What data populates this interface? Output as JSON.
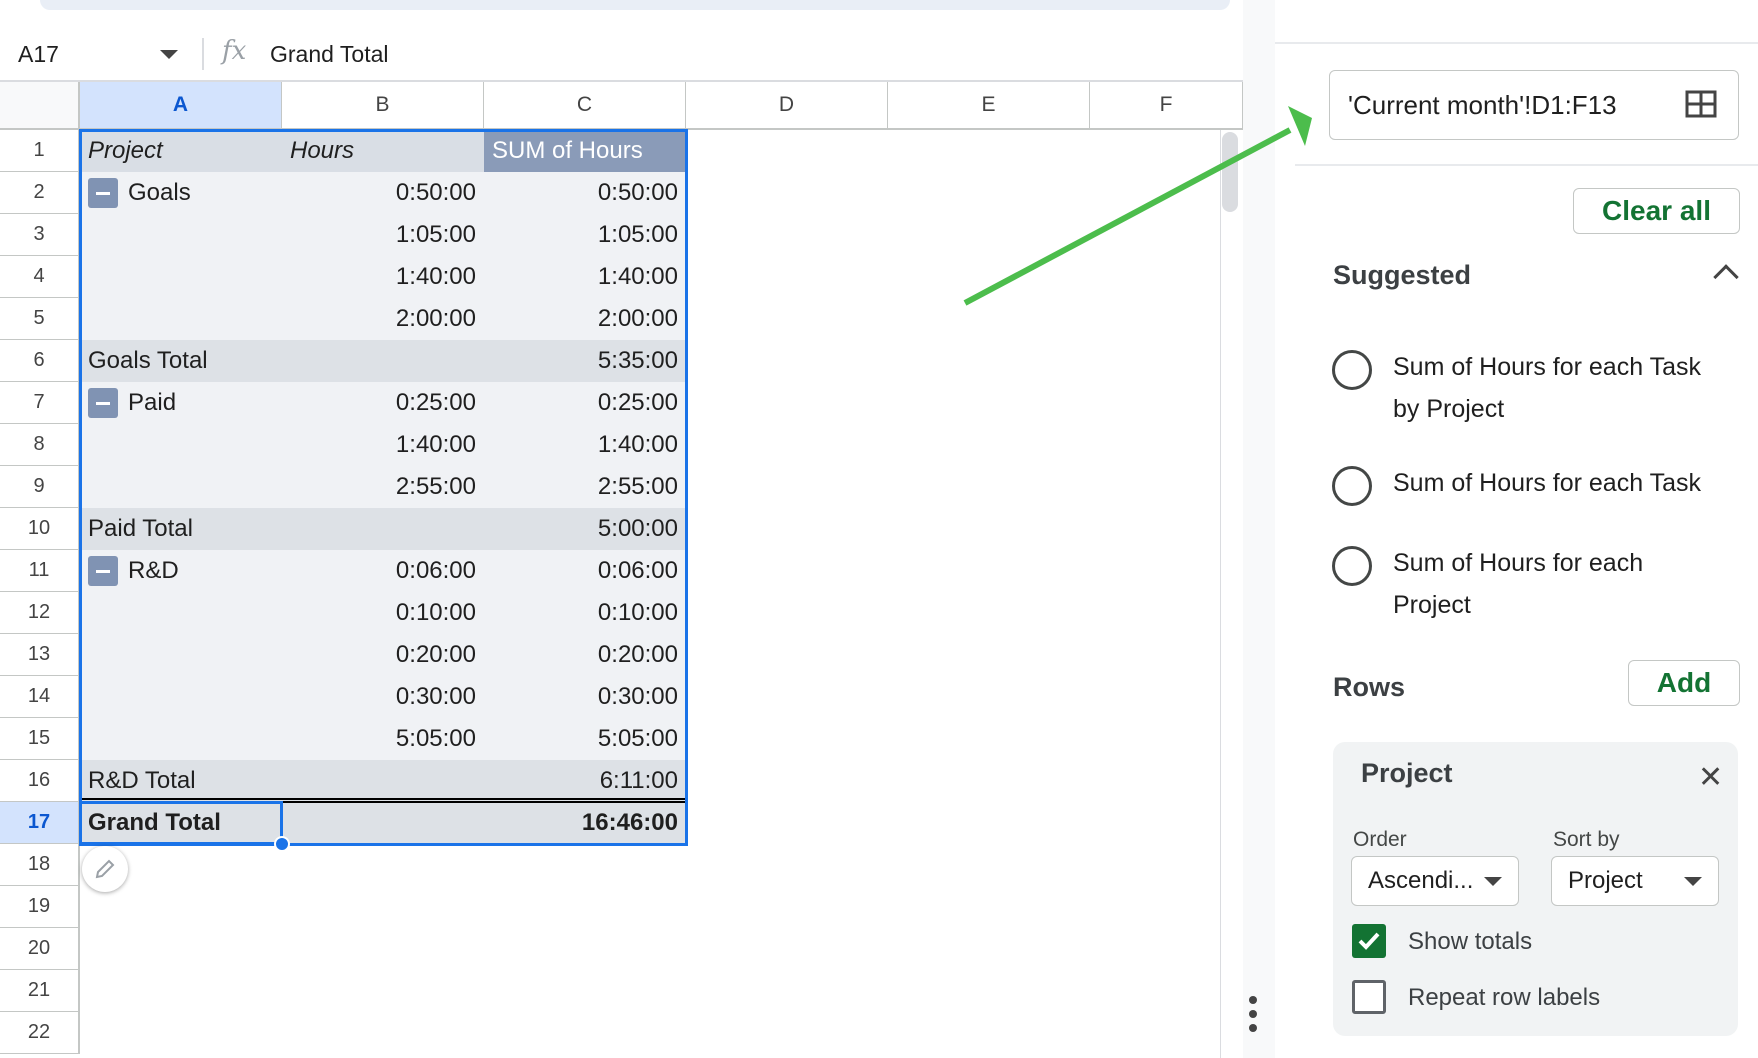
{
  "formula_bar": {
    "name_box": "A17",
    "fx_label": "fx",
    "content": "Grand Total"
  },
  "columns": [
    "A",
    "B",
    "C",
    "D",
    "E",
    "F"
  ],
  "row_numbers": [
    "1",
    "2",
    "3",
    "4",
    "5",
    "6",
    "7",
    "8",
    "9",
    "10",
    "11",
    "12",
    "13",
    "14",
    "15",
    "16",
    "17",
    "18",
    "19",
    "20",
    "21",
    "22"
  ],
  "pivot": {
    "header": {
      "project": "Project",
      "hours": "Hours",
      "sum": "SUM of Hours"
    },
    "groups": [
      {
        "name": "Goals",
        "hours": [
          "0:50:00",
          "1:05:00",
          "1:40:00",
          "2:00:00"
        ],
        "sums": [
          "0:50:00",
          "1:05:00",
          "1:40:00",
          "2:00:00"
        ],
        "total_label": "Goals Total",
        "total": "5:35:00"
      },
      {
        "name": "Paid",
        "hours": [
          "0:25:00",
          "1:40:00",
          "2:55:00"
        ],
        "sums": [
          "0:25:00",
          "1:40:00",
          "2:55:00"
        ],
        "total_label": "Paid Total",
        "total": "5:00:00"
      },
      {
        "name": "R&D",
        "hours": [
          "0:06:00",
          "0:10:00",
          "0:20:00",
          "0:30:00",
          "5:05:00"
        ],
        "sums": [
          "0:06:00",
          "0:10:00",
          "0:20:00",
          "0:30:00",
          "5:05:00"
        ],
        "total_label": "R&D Total",
        "total": "6:11:00"
      }
    ],
    "grand_total_label": "Grand Total",
    "grand_total": "16:46:00"
  },
  "editor": {
    "range": "'Current month'!D1:F13",
    "clear_all": "Clear all",
    "suggested_title": "Suggested",
    "suggestions": [
      {
        "line1": "Sum of Hours for each Task",
        "line2": "by Project"
      },
      {
        "line1": "Sum of Hours for each Task",
        "line2": ""
      },
      {
        "line1": "Sum of Hours for each",
        "line2": "Project"
      }
    ],
    "rows_title": "Rows",
    "add": "Add",
    "row_card": {
      "field": "Project",
      "order_label": "Order",
      "order_value": "Ascendi...",
      "sortby_label": "Sort by",
      "sortby_value": "Project",
      "show_totals": "Show totals",
      "show_totals_checked": true,
      "repeat_labels": "Repeat row labels",
      "repeat_labels_checked": false
    }
  },
  "colors": {
    "accent_green": "#137333",
    "selection_blue": "#1a73e8",
    "annotation_arrow": "#4cbd4c"
  }
}
